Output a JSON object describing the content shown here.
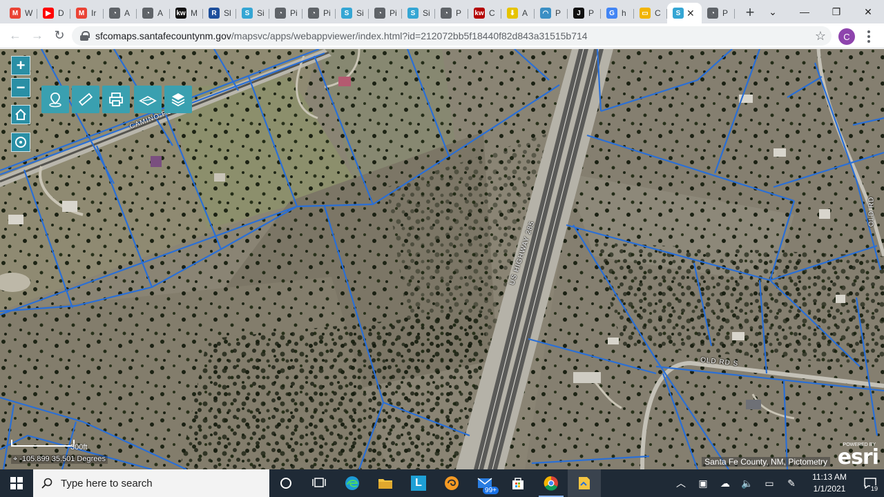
{
  "browser": {
    "tabs": [
      {
        "label": "W",
        "icon": "gmail-icon",
        "color": "#ea4335",
        "glyph": "M"
      },
      {
        "label": "D",
        "icon": "youtube-icon",
        "color": "#ff0000",
        "glyph": "▶"
      },
      {
        "label": "Ir",
        "icon": "gmail-icon",
        "color": "#ea4335",
        "glyph": "M"
      },
      {
        "label": "A",
        "icon": "globe-icon",
        "color": "#5f6368",
        "glyph": "◔"
      },
      {
        "label": "A",
        "icon": "globe-icon",
        "color": "#5f6368",
        "glyph": "◔"
      },
      {
        "label": "M",
        "icon": "kw-icon",
        "color": "#111111",
        "glyph": "kw"
      },
      {
        "label": "Sl",
        "icon": "r-icon",
        "color": "#1e4f9c",
        "glyph": "R"
      },
      {
        "label": "Si",
        "icon": "arcgis-icon",
        "color": "#35a6d4",
        "glyph": "S"
      },
      {
        "label": "Pi",
        "icon": "globe-icon",
        "color": "#5f6368",
        "glyph": "◔"
      },
      {
        "label": "Pi",
        "icon": "globe-icon",
        "color": "#5f6368",
        "glyph": "◔"
      },
      {
        "label": "Si",
        "icon": "arcgis-icon",
        "color": "#35a6d4",
        "glyph": "S"
      },
      {
        "label": "Pi",
        "icon": "globe-icon",
        "color": "#5f6368",
        "glyph": "◔"
      },
      {
        "label": "Si",
        "icon": "arcgis-icon",
        "color": "#35a6d4",
        "glyph": "S"
      },
      {
        "label": "P",
        "icon": "globe-icon",
        "color": "#5f6368",
        "glyph": "◔"
      },
      {
        "label": "C",
        "icon": "kw-icon",
        "color": "#b40101",
        "glyph": "kw"
      },
      {
        "label": "A",
        "icon": "download-icon",
        "color": "#e6c300",
        "glyph": "⬇"
      },
      {
        "label": "P",
        "icon": "gauge-icon",
        "color": "#3b8fc4",
        "glyph": "◠"
      },
      {
        "label": "P",
        "icon": "j-icon",
        "color": "#111111",
        "glyph": "J"
      },
      {
        "label": "h",
        "icon": "google-icon",
        "color": "#4285f4",
        "glyph": "G"
      },
      {
        "label": "C",
        "icon": "folder-icon",
        "color": "#f2b400",
        "glyph": "▭"
      }
    ],
    "active_tab": {
      "icon": "arcgis-icon",
      "color": "#35a6d4",
      "glyph": "S"
    },
    "last_tab": {
      "label": "P",
      "icon": "globe-icon",
      "color": "#5f6368",
      "glyph": "◔"
    },
    "url_host": "sfcomaps.santafecountynm.gov",
    "url_path": "/mapsvc/apps/webappviewer/index.html?id=212072bb5f18440f82d843a31515b714",
    "profile_initial": "C"
  },
  "map": {
    "zoom_in": "+",
    "zoom_out": "−",
    "road_labels": [
      "CAMINO PC",
      "US HIGHWAY 285",
      "OLD RD S",
      "OLD RD"
    ],
    "scale_label": "300ft",
    "coordinates": "-105.899 35.501 Degrees",
    "attribution": "Santa Fe County, NM, Pictometry",
    "esri_powered": "POWERED BY",
    "esri_logo": "esri",
    "parcel_color": "#2a6fd6"
  },
  "taskbar": {
    "search_placeholder": "Type here to search",
    "mail_badge": "99+",
    "time": "11:13 AM",
    "date": "1/1/2021",
    "notification_count": "19"
  }
}
